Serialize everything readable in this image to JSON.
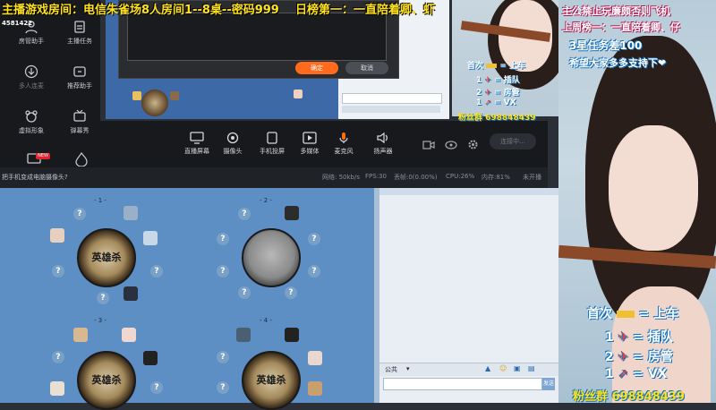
{
  "colors": {
    "banner_yellow": "#ffe21a",
    "banner_white": "#ffffff",
    "banner_cyan": "#52e0ff",
    "accent_orange": "#ff6a1c"
  },
  "overlay": {
    "top_banner": "主播游戏房间：电信朱雀场8人房间1--8桌--密码999",
    "top_banner_right": "日榜第一：一直陪着卿、虾",
    "room_id": "4581422",
    "right_line1": "主公禁止玩廉颇否则飞机",
    "right_line2": "上周榜一：一直陪着卿、仔",
    "right_line3": "3星任务差100",
    "right_line4": "希望大家多多支持下❤",
    "price_lines": [
      {
        "qty": "首次",
        "icon": "gold-bar-icon",
        "meaning": "上车"
      },
      {
        "qty": "1",
        "icon": "plane-icon",
        "meaning": "插队"
      },
      {
        "qty": "2",
        "icon": "plane-icon",
        "meaning": "房管"
      },
      {
        "qty": "1",
        "icon": "rocket-icon",
        "meaning": "VX"
      }
    ],
    "fans_group": "粉丝群 698848439",
    "small_price_lines": [
      {
        "qty": "首次",
        "meaning": "上车"
      },
      {
        "qty": "1",
        "meaning": "插队"
      },
      {
        "qty": "2",
        "meaning": "房管"
      },
      {
        "qty": "1",
        "meaning": "VX"
      }
    ],
    "small_fans_group": "粉丝群 698848439"
  },
  "tool_panel": {
    "items": [
      {
        "label": "房管助手",
        "icon": "person-shield-icon"
      },
      {
        "label": "主播任务",
        "icon": "task-icon"
      },
      {
        "label": "多人连麦",
        "icon": "download-icon"
      },
      {
        "label": "推荐助手",
        "icon": "recommend-icon"
      },
      {
        "label": "虚拟形象",
        "icon": "bear-icon"
      },
      {
        "label": "弹幕秀",
        "icon": "tv-icon"
      }
    ],
    "new_badge": "NEW"
  },
  "toolbar": {
    "items": [
      {
        "label": "直播屏幕",
        "icon": "screen-icon"
      },
      {
        "label": "摄像头",
        "icon": "camera-icon"
      },
      {
        "label": "手机投屏",
        "icon": "phone-icon"
      },
      {
        "label": "多媒体",
        "icon": "media-icon"
      },
      {
        "label": "麦克风",
        "icon": "mic-icon"
      },
      {
        "label": "扬声器",
        "icon": "speaker-icon"
      }
    ],
    "connect_button": "连接中..."
  },
  "status_bar": {
    "hint": "把手机变成电脑摄像头?",
    "network": "网络: 50kb/s",
    "fps": "FPS:30",
    "drop": "丢帧:0(0.00%)",
    "cpu": "CPU:26%",
    "memory": "内存:81%",
    "live": "未开播"
  },
  "dialog": {
    "confirm": "确定",
    "cancel": "取消"
  },
  "game": {
    "tables": [
      {
        "num": "- 1 -",
        "logo": "英雄杀"
      },
      {
        "num": "- 2 -",
        "logo": ""
      },
      {
        "num": "- 3 -",
        "logo": "英雄杀"
      },
      {
        "num": "- 4 -",
        "logo": "英雄杀"
      }
    ],
    "seat_mark": "?",
    "chat_channel": "公共",
    "send_label": "发送"
  }
}
